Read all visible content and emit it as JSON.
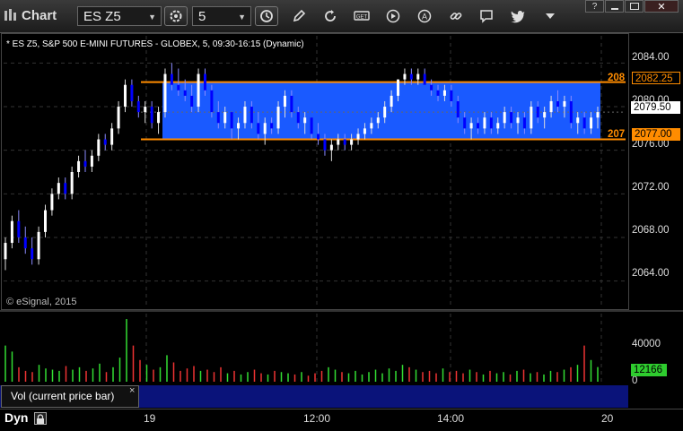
{
  "app": {
    "title": "Chart"
  },
  "toolbar": {
    "symbol": "ES Z5",
    "interval": "5",
    "icons": [
      "settings-icon",
      "clock-icon",
      "pencil-icon",
      "refresh-icon",
      "get-icon",
      "play-icon",
      "a-icon",
      "link-icon",
      "comment-icon",
      "twitter-icon",
      "dropdown-icon"
    ]
  },
  "window_controls": [
    "help",
    "minimize",
    "maximize",
    "close"
  ],
  "chart": {
    "label": "* ES Z5, S&P 500 E-MINI FUTURES - GLOBEX, 5, 09:30-16:15 (Dynamic)",
    "copyright": "© eSignal, 2015",
    "price_ticks": [
      "2084.00",
      "2080.00",
      "2076.00",
      "2072.00",
      "2068.00",
      "2064.00"
    ],
    "badges": {
      "upper_left": "208",
      "upper": "2082.25",
      "current": "2079.50",
      "lower_left": "207",
      "lower": "2077.00"
    },
    "colors": {
      "band": "#1a5aff",
      "line": "#ff8c00",
      "up": "#ffffff",
      "down": "#0000ff"
    }
  },
  "volume": {
    "label": "Vol (current price bar)",
    "close_symbol": "×",
    "ticks": [
      "40000",
      "0"
    ],
    "current": "12166"
  },
  "time_axis": {
    "mode": "Dyn",
    "ticks": [
      "19",
      "12:00",
      "14:00",
      "20"
    ]
  },
  "chart_data": {
    "type": "candlestick",
    "title": "* ES Z5, S&P 500 E-MINI FUTURES - GLOBEX, 5, 09:30-16:15 (Dynamic)",
    "ylim": [
      2061.5,
      2086.5
    ],
    "y_ticks": [
      2084,
      2080,
      2076,
      2072,
      2068,
      2064
    ],
    "x_ticks": [
      "19",
      "12:00",
      "14:00",
      "20"
    ],
    "band": {
      "upper": 2082.25,
      "lower": 2077.0
    },
    "last_price": 2079.5,
    "candles": [
      [
        2066.0,
        2068.0,
        2065.0,
        2067.5
      ],
      [
        2067.5,
        2070.0,
        2067.0,
        2069.5
      ],
      [
        2069.5,
        2070.5,
        2067.5,
        2068.0
      ],
      [
        2068.0,
        2069.0,
        2066.5,
        2067.0
      ],
      [
        2067.0,
        2068.0,
        2065.5,
        2066.0
      ],
      [
        2066.0,
        2069.0,
        2065.5,
        2068.5
      ],
      [
        2068.5,
        2071.0,
        2068.0,
        2070.5
      ],
      [
        2070.5,
        2072.5,
        2070.0,
        2072.0
      ],
      [
        2072.0,
        2073.5,
        2071.5,
        2073.0
      ],
      [
        2073.0,
        2073.5,
        2071.5,
        2072.0
      ],
      [
        2072.0,
        2074.5,
        2071.5,
        2074.0
      ],
      [
        2074.0,
        2075.5,
        2073.5,
        2075.0
      ],
      [
        2075.0,
        2076.0,
        2074.0,
        2074.5
      ],
      [
        2074.5,
        2076.0,
        2074.0,
        2075.5
      ],
      [
        2075.5,
        2077.5,
        2075.0,
        2077.0
      ],
      [
        2077.0,
        2077.5,
        2076.0,
        2076.5
      ],
      [
        2076.5,
        2078.5,
        2076.0,
        2078.0
      ],
      [
        2078.0,
        2080.5,
        2077.5,
        2080.0
      ],
      [
        2080.0,
        2082.5,
        2079.5,
        2082.0
      ],
      [
        2082.0,
        2082.5,
        2080.0,
        2080.5
      ],
      [
        2080.5,
        2081.0,
        2079.0,
        2079.5
      ],
      [
        2079.5,
        2080.5,
        2078.5,
        2080.0
      ],
      [
        2080.0,
        2080.5,
        2078.0,
        2078.5
      ],
      [
        2078.5,
        2080.0,
        2077.5,
        2079.5
      ],
      [
        2079.5,
        2083.5,
        2079.0,
        2083.0
      ],
      [
        2083.0,
        2084.0,
        2081.5,
        2082.0
      ],
      [
        2082.0,
        2083.5,
        2081.0,
        2081.5
      ],
      [
        2081.5,
        2082.5,
        2080.5,
        2081.0
      ],
      [
        2081.0,
        2082.0,
        2079.5,
        2080.0
      ],
      [
        2080.0,
        2083.5,
        2079.5,
        2083.0
      ],
      [
        2083.0,
        2083.5,
        2081.0,
        2081.5
      ],
      [
        2081.5,
        2082.0,
        2079.0,
        2079.5
      ],
      [
        2079.5,
        2080.5,
        2078.0,
        2078.5
      ],
      [
        2078.5,
        2080.0,
        2078.0,
        2079.5
      ],
      [
        2079.5,
        2079.5,
        2077.0,
        2078.0
      ],
      [
        2078.0,
        2079.0,
        2077.0,
        2078.5
      ],
      [
        2078.5,
        2080.5,
        2078.0,
        2080.0
      ],
      [
        2080.0,
        2080.5,
        2078.0,
        2078.5
      ],
      [
        2078.5,
        2079.5,
        2077.0,
        2077.5
      ],
      [
        2077.5,
        2079.0,
        2076.5,
        2078.5
      ],
      [
        2078.5,
        2079.0,
        2077.5,
        2078.0
      ],
      [
        2078.0,
        2080.5,
        2077.5,
        2080.0
      ],
      [
        2080.0,
        2081.5,
        2079.0,
        2081.0
      ],
      [
        2081.0,
        2081.5,
        2079.0,
        2079.5
      ],
      [
        2079.5,
        2080.0,
        2078.0,
        2078.5
      ],
      [
        2078.5,
        2079.5,
        2077.5,
        2079.0
      ],
      [
        2079.0,
        2079.0,
        2077.0,
        2077.5
      ],
      [
        2077.5,
        2078.5,
        2076.5,
        2077.0
      ],
      [
        2077.0,
        2077.5,
        2075.5,
        2076.0
      ],
      [
        2076.0,
        2077.0,
        2075.0,
        2076.5
      ],
      [
        2076.5,
        2077.5,
        2076.0,
        2077.0
      ],
      [
        2077.0,
        2077.5,
        2076.0,
        2076.5
      ],
      [
        2076.5,
        2077.5,
        2076.0,
        2077.0
      ],
      [
        2077.0,
        2078.0,
        2076.5,
        2077.5
      ],
      [
        2077.5,
        2078.5,
        2077.0,
        2078.0
      ],
      [
        2078.0,
        2079.0,
        2077.5,
        2078.5
      ],
      [
        2078.5,
        2079.5,
        2078.0,
        2079.0
      ],
      [
        2079.0,
        2080.5,
        2078.5,
        2080.0
      ],
      [
        2080.0,
        2081.5,
        2079.5,
        2081.0
      ],
      [
        2081.0,
        2082.5,
        2080.5,
        2082.5
      ],
      [
        2082.5,
        2083.5,
        2082.0,
        2083.0
      ],
      [
        2083.0,
        2083.5,
        2082.0,
        2082.5
      ],
      [
        2082.5,
        2083.5,
        2082.0,
        2083.0
      ],
      [
        2083.0,
        2083.5,
        2082.0,
        2082.0
      ],
      [
        2082.0,
        2082.5,
        2081.0,
        2081.5
      ],
      [
        2081.5,
        2082.0,
        2080.5,
        2081.0
      ],
      [
        2081.0,
        2082.0,
        2080.5,
        2081.5
      ],
      [
        2081.5,
        2082.0,
        2080.0,
        2080.5
      ],
      [
        2080.5,
        2081.0,
        2078.5,
        2079.0
      ],
      [
        2079.0,
        2079.5,
        2077.5,
        2078.0
      ],
      [
        2078.0,
        2079.0,
        2077.0,
        2078.5
      ],
      [
        2078.5,
        2079.0,
        2077.5,
        2078.0
      ],
      [
        2078.0,
        2079.5,
        2077.5,
        2079.0
      ],
      [
        2079.0,
        2079.5,
        2077.5,
        2078.0
      ],
      [
        2078.0,
        2079.0,
        2077.5,
        2078.5
      ],
      [
        2078.5,
        2080.0,
        2078.0,
        2079.5
      ],
      [
        2079.5,
        2080.0,
        2078.0,
        2078.5
      ],
      [
        2078.5,
        2079.5,
        2077.5,
        2079.0
      ],
      [
        2079.0,
        2079.5,
        2077.5,
        2078.0
      ],
      [
        2078.0,
        2080.5,
        2077.5,
        2080.0
      ],
      [
        2080.0,
        2080.5,
        2078.5,
        2079.0
      ],
      [
        2079.0,
        2080.0,
        2078.0,
        2079.5
      ],
      [
        2079.5,
        2081.0,
        2079.0,
        2080.5
      ],
      [
        2080.5,
        2081.5,
        2079.5,
        2080.0
      ],
      [
        2080.0,
        2081.0,
        2079.0,
        2080.5
      ],
      [
        2080.5,
        2081.0,
        2078.0,
        2078.5
      ],
      [
        2078.5,
        2079.5,
        2077.5,
        2079.0
      ],
      [
        2079.0,
        2079.5,
        2077.5,
        2078.0
      ],
      [
        2078.0,
        2079.5,
        2077.5,
        2079.0
      ],
      [
        2079.0,
        2080.0,
        2078.0,
        2079.5
      ]
    ],
    "volume_ylim": [
      0,
      55000
    ],
    "volume_ticks": [
      40000,
      0
    ],
    "volume": [
      30000,
      25000,
      12000,
      9000,
      8000,
      14000,
      11000,
      10000,
      9000,
      13000,
      10000,
      12000,
      9000,
      11000,
      15000,
      8000,
      12000,
      20000,
      52000,
      30000,
      18000,
      14000,
      10000,
      12000,
      22000,
      16000,
      9000,
      11000,
      13000,
      9000,
      10000,
      8000,
      12000,
      7000,
      9000,
      6000,
      8000,
      10000,
      7000,
      6000,
      9000,
      8000,
      7000,
      6000,
      8000,
      5000,
      7000,
      9000,
      12000,
      10000,
      8000,
      7000,
      9000,
      6000,
      8000,
      10000,
      7000,
      11000,
      9000,
      14000,
      12000,
      10000,
      8000,
      9000,
      7000,
      11000,
      8000,
      9000,
      7000,
      10000,
      8000,
      6000,
      9000,
      7000,
      8000,
      6000,
      9000,
      10000,
      7000,
      8000,
      6000,
      9000,
      8000,
      10000,
      12000,
      14000,
      30000,
      18000,
      12166
    ]
  }
}
